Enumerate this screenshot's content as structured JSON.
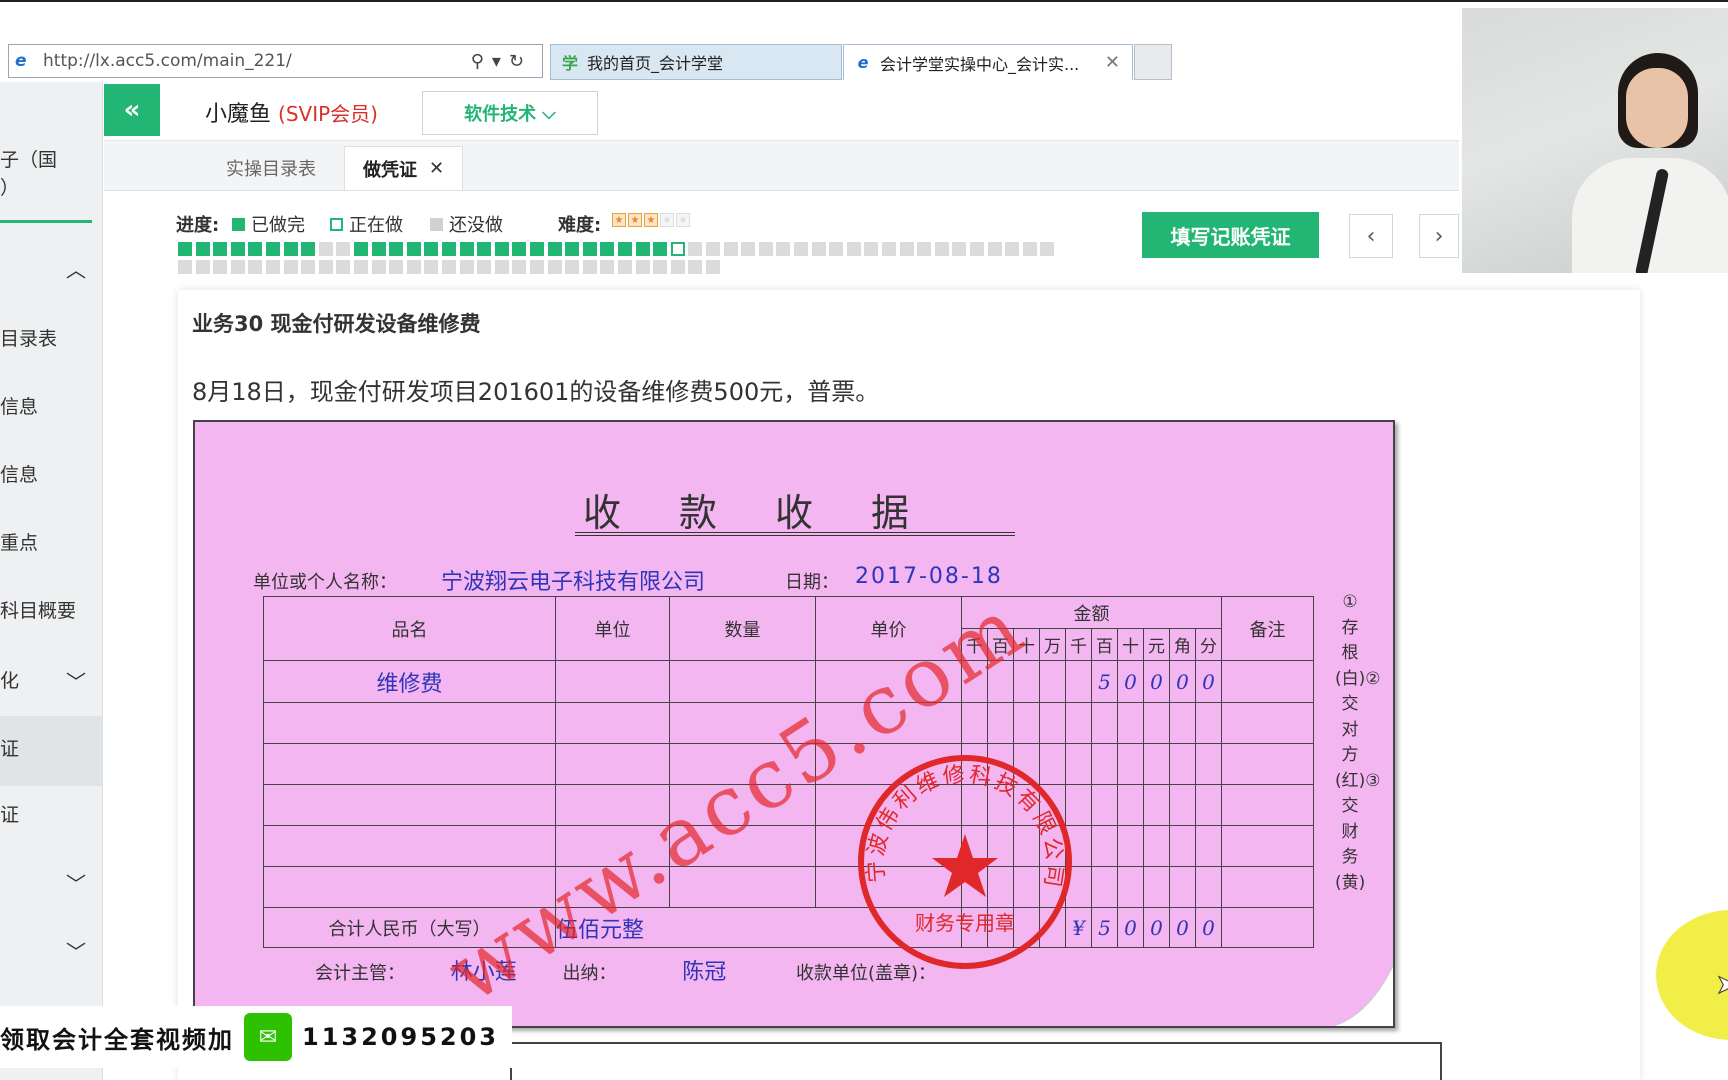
{
  "browser": {
    "url": "http://lx.acc5.com/main_221/",
    "tabs": [
      {
        "label": "我的首页_会计学堂",
        "icon": "acc5-logo-icon"
      },
      {
        "label": "会计学堂实操中心_会计实...",
        "icon": "ie-icon"
      }
    ]
  },
  "sidebar": {
    "user_fragment": "子（国\n）",
    "items": [
      "目录表",
      "信息",
      "信息",
      "重点",
      "科目概要",
      "化",
      "证",
      "证"
    ]
  },
  "header": {
    "user_name": "小魔鱼",
    "user_badge": "(SVIP会员)",
    "menu_label": "软件技术"
  },
  "page_tabs": {
    "catalog": "实操目录表",
    "voucher": "做凭证"
  },
  "progress": {
    "label": "进度:",
    "done": "已做完",
    "doing": "正在做",
    "todo": "还没做",
    "difficulty_label": "难度:",
    "difficulty_stars": 3,
    "difficulty_max": 5,
    "row1_done": 28,
    "row1_total": 50,
    "row2_total": 31
  },
  "actions": {
    "fill_voucher": "填写记账凭证"
  },
  "business": {
    "title": "业务30 现金付研发设备维修费",
    "description": "8月18日，现金付研发项目201601的设备维修费500元，普票。"
  },
  "receipt": {
    "title": "收款收据",
    "payer_label": "单位或个人名称：",
    "payer": "宁波翔云电子科技有限公司",
    "date_label": "日期：",
    "date": "2017-08-18",
    "headers": {
      "item": "品名",
      "unit": "单位",
      "qty": "数量",
      "price": "单价",
      "amount": "金额",
      "remark": "备注"
    },
    "digit_headers": [
      "千",
      "百",
      "十",
      "万",
      "千",
      "百",
      "十",
      "元",
      "角",
      "分"
    ],
    "item_name": "维修费",
    "row1_digits": [
      "",
      "",
      "",
      "",
      "",
      "5",
      "0",
      "0",
      "0",
      "0"
    ],
    "total_label": "合计人民币（大写）",
    "total_words": "伍佰元整",
    "total_digits": [
      "",
      "",
      "",
      "",
      "¥",
      "5",
      "0",
      "0",
      "0",
      "0"
    ],
    "copies": "①存根(白)②交对方(红)③交财务(黄)",
    "accountant_label": "会计主管：",
    "accountant": "林小莲",
    "cashier_label": "出纳：",
    "cashier": "陈冠",
    "stamp_label": "收款单位(盖章)：",
    "watermark": "www.acc5.com",
    "seal_company": "宁波伟利维修科技有限公司",
    "seal_purpose": "财务专用章"
  },
  "promo": {
    "text": "领取会计全套视频加",
    "number": "1132095203"
  }
}
